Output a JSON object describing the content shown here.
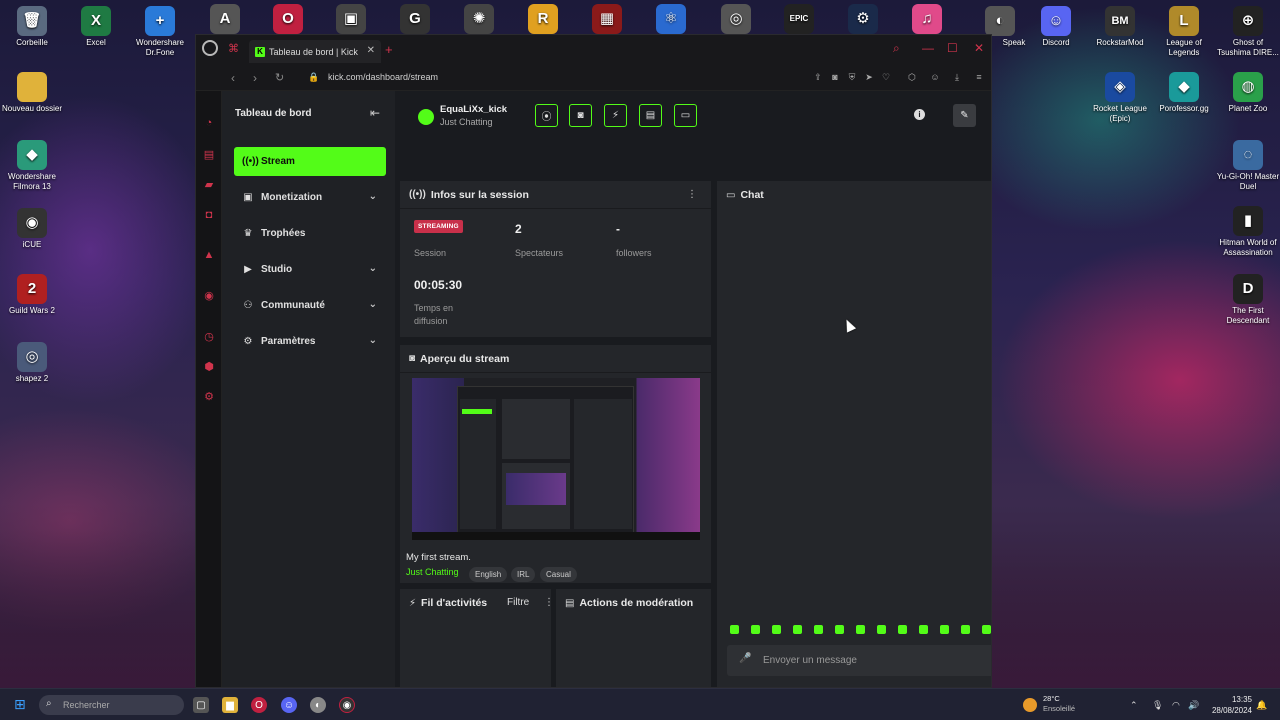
{
  "desktop": {
    "icons": [
      {
        "label": "Corbeille",
        "icon": "recycle-bin-icon",
        "glyph": "🗑",
        "color": "#5a6a80"
      },
      {
        "label": "Excel",
        "icon": "excel-icon",
        "glyph": "X",
        "color": "#1f7a43"
      },
      {
        "label": "Wondershare Dr.Fone",
        "icon": "drfone-icon",
        "glyph": "+",
        "color": "#2a7ad8"
      },
      {
        "label": "Nouveau dossier",
        "icon": "folder-icon",
        "glyph": "",
        "color": "#e0b23a"
      },
      {
        "label": "Wondershare Filmora 13",
        "icon": "filmora-icon",
        "glyph": "◆",
        "color": "#2a9a7a"
      },
      {
        "label": "iCUE",
        "icon": "icue-icon",
        "glyph": "◉",
        "color": "#333"
      },
      {
        "label": "Guild Wars 2",
        "icon": "guildwars-icon",
        "glyph": "2",
        "color": "#b02020"
      },
      {
        "label": "shapez 2",
        "icon": "shapez-icon",
        "glyph": "◎",
        "color": "#4a5a7a"
      },
      {
        "label": "Speak",
        "icon": "speak-icon",
        "glyph": "◐",
        "color": "#555"
      },
      {
        "label": "Discord",
        "icon": "discord-icon",
        "glyph": "☺",
        "color": "#5865f2"
      },
      {
        "label": "RockstarMod",
        "icon": "rockstarmod-icon",
        "glyph": "BM",
        "color": "#333"
      },
      {
        "label": "League of Legends",
        "icon": "league-icon",
        "glyph": "L",
        "color": "#b08a2a"
      },
      {
        "label": "Ghost of Tsushima DIRE...",
        "icon": "ghost-icon",
        "glyph": "⊕",
        "color": "#222"
      },
      {
        "label": "Rocket League (Epic)",
        "icon": "rocket-league-icon",
        "glyph": "◈",
        "color": "#1a4aa0"
      },
      {
        "label": "Porofessor.gg",
        "icon": "porofessor-icon",
        "glyph": "◆",
        "color": "#1a9a9a"
      },
      {
        "label": "Planet Zoo",
        "icon": "planet-zoo-icon",
        "glyph": "◍",
        "color": "#2aa04a"
      },
      {
        "label": "Yu-Gi-Oh! Master Duel",
        "icon": "yugioh-icon",
        "glyph": "◌",
        "color": "#3a6aa0"
      },
      {
        "label": "Hitman World of Assassination",
        "icon": "hitman-icon",
        "glyph": "▮",
        "color": "#222"
      },
      {
        "label": "The First Descendant",
        "icon": "first-descendant-icon",
        "glyph": "D",
        "color": "#222"
      }
    ],
    "top_icons": [
      {
        "icon": "ark-icon",
        "glyph": "A",
        "color": "#555"
      },
      {
        "icon": "opera-gx-icon",
        "glyph": "O",
        "color": "#c02040"
      },
      {
        "icon": "app-shield-icon",
        "glyph": "▣",
        "color": "#444"
      },
      {
        "icon": "logitech-icon",
        "glyph": "G",
        "color": "#333"
      },
      {
        "icon": "wolf-icon",
        "glyph": "✺",
        "color": "#444"
      },
      {
        "icon": "rockstar-icon",
        "glyph": "R",
        "color": "#e0a020"
      },
      {
        "icon": "rdr2-icon",
        "glyph": "▦",
        "color": "#8a1a1a"
      },
      {
        "icon": "atom-icon",
        "glyph": "⚛",
        "color": "#2a6ad0"
      },
      {
        "icon": "ubisoft-icon",
        "glyph": "◎",
        "color": "#555"
      },
      {
        "icon": "epic-games-icon",
        "glyph": "EPIC",
        "color": "#222"
      },
      {
        "icon": "steam-icon",
        "glyph": "⚙",
        "color": "#1a2a4a"
      },
      {
        "icon": "itunes-icon",
        "glyph": "♫",
        "color": "#e04a8a"
      }
    ]
  },
  "browser": {
    "tab_title": "Tableau de bord | Kick",
    "tab_favicon": "K",
    "url": "kick.com/dashboard/stream"
  },
  "dashboard": {
    "sidebar_title": "Tableau de bord",
    "nav": [
      {
        "label": "Stream",
        "icon": "broadcast-icon",
        "glyph": "((•))",
        "active": true,
        "has_chevron": false
      },
      {
        "label": "Monetization",
        "icon": "monetization-icon",
        "glyph": "▣",
        "active": false,
        "has_chevron": true
      },
      {
        "label": "Trophées",
        "icon": "trophy-icon",
        "glyph": "🏆",
        "active": false,
        "has_chevron": false
      },
      {
        "label": "Studio",
        "icon": "studio-icon",
        "glyph": "▶",
        "active": false,
        "has_chevron": true
      },
      {
        "label": "Communauté",
        "icon": "community-icon",
        "glyph": "👥",
        "active": false,
        "has_chevron": true
      },
      {
        "label": "Paramètres",
        "icon": "settings-icon",
        "glyph": "⚙",
        "active": false,
        "has_chevron": true
      }
    ],
    "channel": {
      "name": "EquaLiXx_kick",
      "category": "Just Chatting"
    },
    "session": {
      "title": "Infos sur la session",
      "badge": "STREAMING",
      "session_label": "Session",
      "viewers_value": "2",
      "viewers_label": "Spectateurs",
      "followers_value": "-",
      "followers_label": "followers",
      "uptime_value": "00:05:30",
      "uptime_label": "Temps en diffusion"
    },
    "preview": {
      "title": "Aperçu du stream",
      "stream_title": "My first stream.",
      "category": "Just Chatting",
      "tags": [
        "English",
        "IRL",
        "Casual"
      ]
    },
    "activity": {
      "title": "Fil d'activités",
      "filter": "Filtre"
    },
    "moderation": {
      "title": "Actions de modération"
    },
    "chat": {
      "title": "Chat",
      "placeholder": "Envoyer un message"
    }
  },
  "taskbar": {
    "search_placeholder": "Rechercher",
    "weather_temp": "28°C",
    "weather_desc": "Ensoleillé",
    "time": "13:35",
    "date": "28/08/2024"
  }
}
